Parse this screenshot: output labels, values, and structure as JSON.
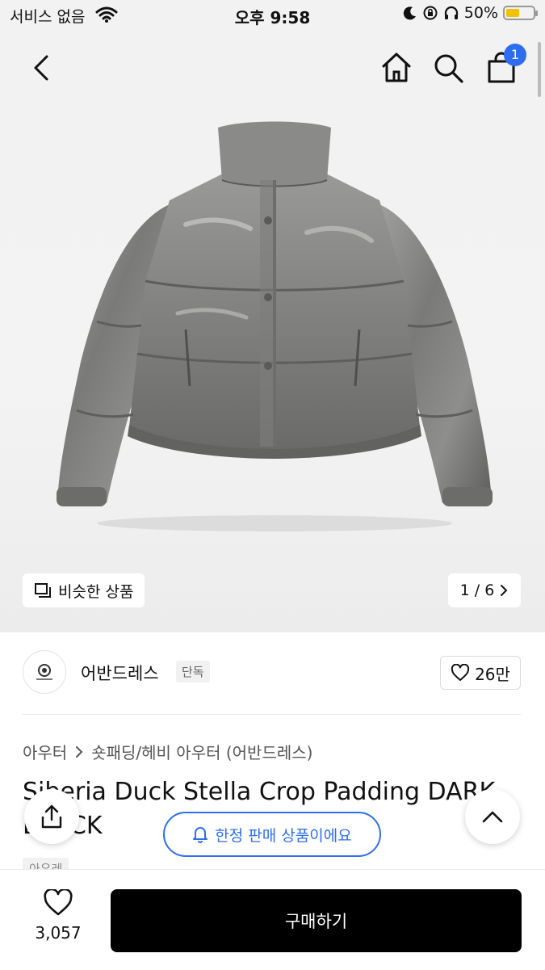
{
  "status_bar": {
    "carrier": "서비스 없음",
    "time": "오후 9:58",
    "battery": "50%"
  },
  "header": {
    "cart_count": "1"
  },
  "gallery": {
    "similar_label": "비슷한 상품",
    "pager": "1 / 6"
  },
  "brand": {
    "name": "어반드레스",
    "tag": "단독",
    "likes": "26만"
  },
  "breadcrumb": {
    "category": "아우터",
    "subcategory": "숏패딩/헤비 아우터 (어반드레스)"
  },
  "product": {
    "title": "Siberia Duck Stella Crop Padding DARK BLACK",
    "tag": "아우레"
  },
  "notice": {
    "label": "한정 판매 상품이에요"
  },
  "bottom_bar": {
    "favorites": "3,057",
    "buy_label": "구매하기"
  },
  "colors": {
    "accent": "#2e6df0",
    "buy_button": "#000000"
  }
}
